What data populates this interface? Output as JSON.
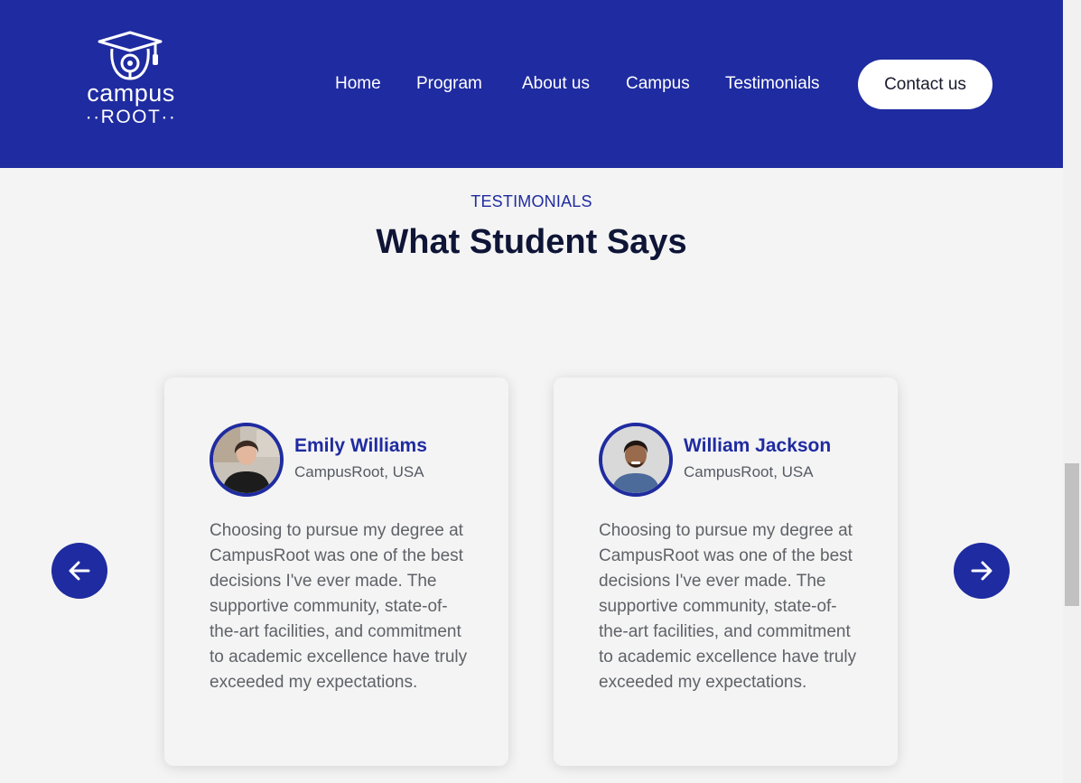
{
  "brand": {
    "name_top": "campus",
    "name_bottom": "··ROOT··",
    "icon": "graduation-owl-logo"
  },
  "nav": {
    "items": [
      {
        "label": "Home"
      },
      {
        "label": "Program"
      },
      {
        "label": "About us"
      },
      {
        "label": "Campus"
      },
      {
        "label": "Testimonials"
      }
    ],
    "contact_label": "Contact us"
  },
  "section": {
    "eyebrow": "TESTIMONIALS",
    "title": "What Student Says"
  },
  "testimonials": [
    {
      "name": "Emily Williams",
      "location": "CampusRoot, USA",
      "quote": "Choosing to pursue my degree at CampusRoot was one of the best decisions I've ever made. The supportive community, state-of-the-art facilities, and commitment to academic excellence have truly exceeded my expectations."
    },
    {
      "name": "William Jackson",
      "location": "CampusRoot, USA",
      "quote": "Choosing to pursue my degree at CampusRoot was one of the best decisions I've ever made. The supportive community, state-of-the-art facilities, and commitment to academic excellence have truly exceeded my expectations."
    }
  ],
  "carousel": {
    "prev_icon": "arrow-left-icon",
    "next_icon": "arrow-right-icon"
  },
  "colors": {
    "primary": "#1f2ba0",
    "background": "#f4f4f4",
    "heading": "#0e1536",
    "body_text": "#5f6268"
  }
}
